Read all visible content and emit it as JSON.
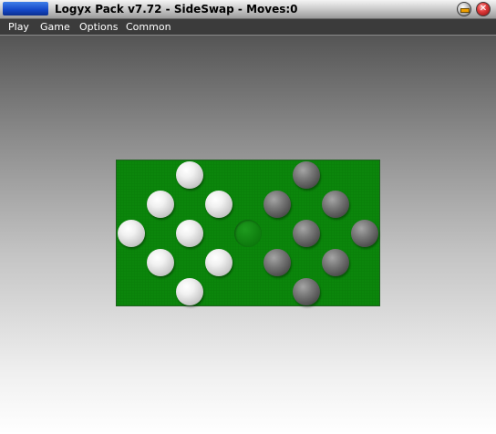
{
  "window": {
    "title": "Logyx Pack v7.72 - SideSwap - Moves:0",
    "accent_color": "#1447c6"
  },
  "menu": {
    "items": [
      {
        "label": "Play"
      },
      {
        "label": "Game"
      },
      {
        "label": "Options"
      },
      {
        "label": "Common"
      }
    ]
  },
  "game": {
    "name": "SideSwap",
    "moves": 0,
    "board_color": "#0b860b",
    "piece_colors": {
      "white": "#e6e6e6",
      "black": "#5a5a5a"
    },
    "cells": [
      {
        "row": 0,
        "col": 2,
        "piece": "white"
      },
      {
        "row": 1,
        "col": 1,
        "piece": "white"
      },
      {
        "row": 1,
        "col": 3,
        "piece": "white"
      },
      {
        "row": 2,
        "col": 0,
        "piece": "white"
      },
      {
        "row": 2,
        "col": 2,
        "piece": "white"
      },
      {
        "row": 3,
        "col": 1,
        "piece": "white"
      },
      {
        "row": 3,
        "col": 3,
        "piece": "white"
      },
      {
        "row": 4,
        "col": 2,
        "piece": "white"
      },
      {
        "row": 2,
        "col": 4,
        "piece": "empty"
      },
      {
        "row": 0,
        "col": 6,
        "piece": "black"
      },
      {
        "row": 1,
        "col": 5,
        "piece": "black"
      },
      {
        "row": 1,
        "col": 7,
        "piece": "black"
      },
      {
        "row": 2,
        "col": 6,
        "piece": "black"
      },
      {
        "row": 2,
        "col": 8,
        "piece": "black"
      },
      {
        "row": 3,
        "col": 5,
        "piece": "black"
      },
      {
        "row": 3,
        "col": 7,
        "piece": "black"
      },
      {
        "row": 4,
        "col": 6,
        "piece": "black"
      }
    ]
  }
}
